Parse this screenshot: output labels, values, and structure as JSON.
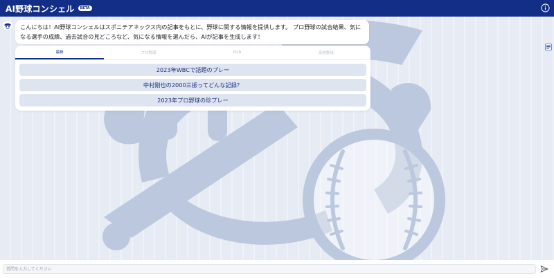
{
  "header": {
    "title": "AI野球コンシェル",
    "badge": "BETA",
    "info_icon": "info-circle-icon"
  },
  "colors": {
    "header_bg": "#132e86",
    "page_bg": "#e6ebf4",
    "mascot": "#bcc8de",
    "button_bg": "#dfe5f0",
    "button_text": "#1a2f7a"
  },
  "chat": {
    "greeting": "こんにちは！AI野球コンシェルはスポニチアネックス内の記事をもとに、野球に関する情報を提供します。 プロ野球の試合結果、気になる選手の成績、過去試合の見どころなど、気になる情報を選んだら、AIが記事を生成します！"
  },
  "tabs": [
    {
      "label": "最新",
      "active": true
    },
    {
      "label": "プロ野球",
      "active": false
    },
    {
      "label": "MLB",
      "active": false
    },
    {
      "label": "高校野球",
      "active": false
    }
  ],
  "suggestions": [
    "2023年WBCで話題のプレー",
    "中村剛也の2000三振ってどんな記録？",
    "2023年プロ野球の珍プレー"
  ],
  "input": {
    "placeholder": "質問を入力してください",
    "send_icon": "send-icon"
  }
}
